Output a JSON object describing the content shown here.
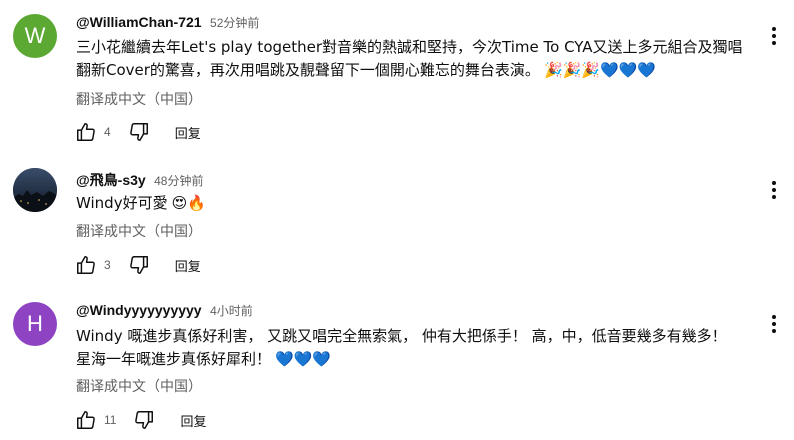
{
  "comments": [
    {
      "avatar_letter": "W",
      "avatar_color": "#5ba832",
      "author": "@WilliamChan-721",
      "time": "52分钟前",
      "text_lines": [
        "三小花繼續去年Let's play together對音樂的熱誠和堅持，今次Time To CYA又送上多元組合及獨唱",
        "翻新Cover的驚喜，再次用唱跳及靚聲留下一個開心難忘的舞台表演。"
      ],
      "emojis": "🎉🎉🎉💙💙💙",
      "translate": "翻译成中文（中国）",
      "likes": "4",
      "reply": "回复"
    },
    {
      "avatar_letter": "",
      "avatar_color": "#1d2a3a",
      "author": "@飛鳥-s3y",
      "time": "48分钟前",
      "text_lines": [
        "Windy好可愛"
      ],
      "emojis": "😍🔥",
      "translate": "翻译成中文（中国）",
      "likes": "3",
      "reply": "回复"
    },
    {
      "avatar_letter": "H",
      "avatar_color": "#8e44c2",
      "author": "@Windyyyyyyyyyy",
      "time": "4小时前",
      "text_lines": [
        "Windy 嘅進步真係好利害， 又跳又唱完全無索氣， 仲有大把係手！ 高，中，低音要幾多有幾多！",
        "星海一年嘅進步真係好犀利！"
      ],
      "emojis": "💙💙💙",
      "translate": "翻译成中文（中国）",
      "likes": "11",
      "reply": "回复"
    }
  ]
}
